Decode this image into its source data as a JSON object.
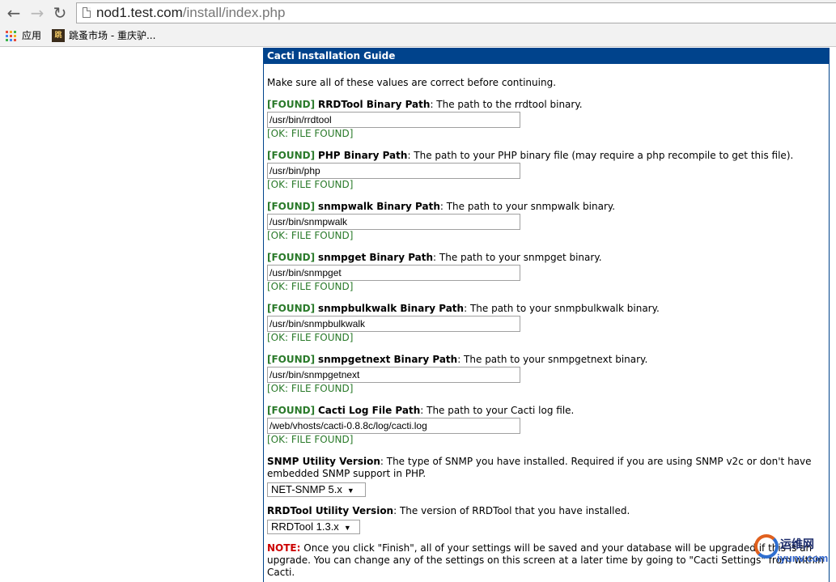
{
  "browser": {
    "url_host": "nod1.test.com",
    "url_path": "/install/index.php",
    "bookmarks": [
      {
        "label": "应用",
        "icon": "apps-grid-icon"
      },
      {
        "label": "跳蚤市场 - 重庆驴...",
        "icon": "site-favicon-icon",
        "favicon_text": "跳"
      }
    ]
  },
  "guide": {
    "header": "Cacti Installation Guide",
    "intro": "Make sure all of these values are correct before continuing.",
    "items": [
      {
        "status": "[FOUND]",
        "title": "RRDTool Binary Path",
        "desc": ": The path to the rrdtool binary.",
        "value": "/usr/bin/rrdtool",
        "ok": "[OK: FILE FOUND]"
      },
      {
        "status": "[FOUND]",
        "title": "PHP Binary Path",
        "desc": ": The path to your PHP binary file (may require a php recompile to get this file).",
        "value": "/usr/bin/php",
        "ok": "[OK: FILE FOUND]"
      },
      {
        "status": "[FOUND]",
        "title": "snmpwalk Binary Path",
        "desc": ": The path to your snmpwalk binary.",
        "value": "/usr/bin/snmpwalk",
        "ok": "[OK: FILE FOUND]"
      },
      {
        "status": "[FOUND]",
        "title": "snmpget Binary Path",
        "desc": ": The path to your snmpget binary.",
        "value": "/usr/bin/snmpget",
        "ok": "[OK: FILE FOUND]"
      },
      {
        "status": "[FOUND]",
        "title": "snmpbulkwalk Binary Path",
        "desc": ": The path to your snmpbulkwalk binary.",
        "value": "/usr/bin/snmpbulkwalk",
        "ok": "[OK: FILE FOUND]"
      },
      {
        "status": "[FOUND]",
        "title": "snmpgetnext Binary Path",
        "desc": ": The path to your snmpgetnext binary.",
        "value": "/usr/bin/snmpgetnext",
        "ok": "[OK: FILE FOUND]"
      },
      {
        "status": "[FOUND]",
        "title": "Cacti Log File Path",
        "desc": ": The path to your Cacti log file.",
        "value": "/web/vhosts/cacti-0.8.8c/log/cacti.log",
        "ok": "[OK: FILE FOUND]"
      }
    ],
    "snmp_utility": {
      "title": "SNMP Utility Version",
      "desc": ": The type of SNMP you have installed. Required if you are using SNMP v2c or don't have embedded SNMP support in PHP.",
      "selected": "NET-SNMP 5.x"
    },
    "rrdtool_utility": {
      "title": "RRDTool Utility Version",
      "desc": ": The version of RRDTool that you have installed.",
      "selected": "RRDTool 1.3.x"
    },
    "note": {
      "label": "NOTE:",
      "text": " Once you click \"Finish\", all of your settings will be saved and your database will be upgraded if this is an upgrade. You can change any of the settings on this screen at a later time by going to \"Cacti Settings\" from within Cacti."
    }
  },
  "watermark": {
    "name": "运维网",
    "url": "iyunv.com"
  },
  "colors": {
    "header_bg": "#00438c",
    "found_green": "#2a7a2a",
    "note_red": "#cc0000"
  }
}
